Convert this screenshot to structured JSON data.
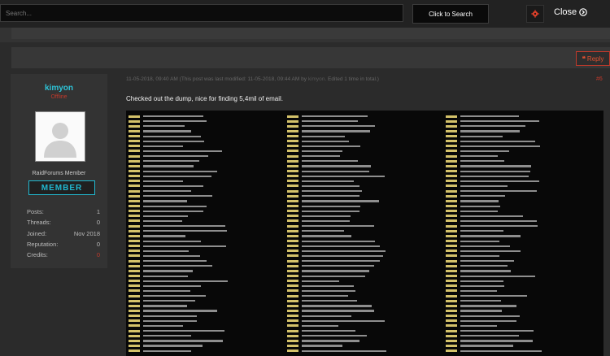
{
  "topbar": {
    "search_placeholder": "Search...",
    "search_button": "Click to Search",
    "close_label": "Close"
  },
  "actions": {
    "reply_label": "Reply"
  },
  "user": {
    "username": "kimyon",
    "status": "Offline",
    "usergroup": "RaidForums Member",
    "badge": "MEMBER",
    "stats": [
      {
        "label": "Posts:",
        "value": "1"
      },
      {
        "label": "Threads:",
        "value": "0"
      },
      {
        "label": "Joined:",
        "value": "Nov 2018"
      },
      {
        "label": "Reputation:",
        "value": "0"
      },
      {
        "label": "Credits:",
        "value": "0"
      }
    ]
  },
  "post": {
    "date": "11-05-2018, 09:40 AM",
    "modified_note": "(This post was last modified: 11-05-2018, 09:44 AM by",
    "modified_by": "kimyon",
    "modified_suffix": ". Edited 1 time in total.)",
    "number": "#6",
    "text": "Checked out the dump, nice for finding 5,4mil of email."
  },
  "colors": {
    "accent": "#2ec4d8",
    "danger": "#c0392b",
    "highlight": "#d4c26a"
  }
}
